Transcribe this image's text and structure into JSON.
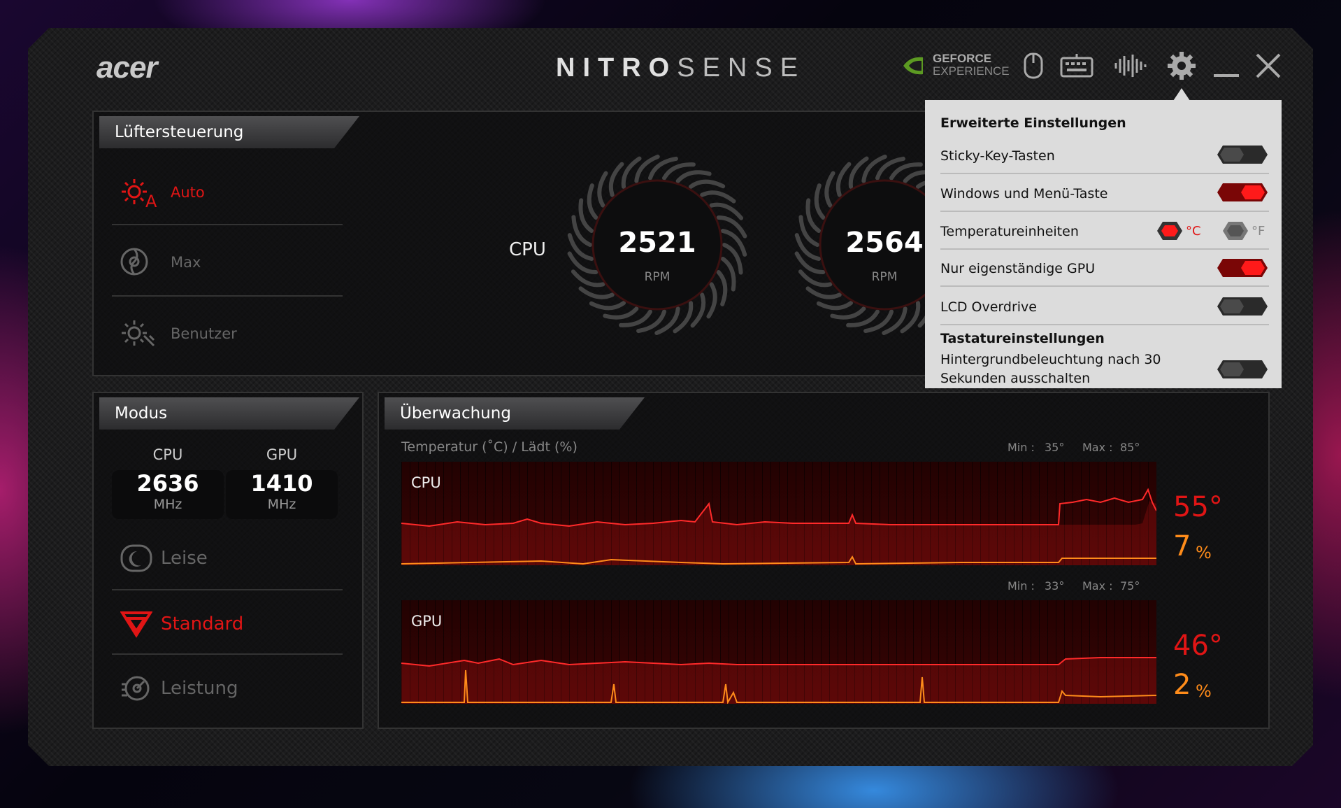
{
  "app": {
    "brand": "acer",
    "title_bold": "NITRO",
    "title_light": "SENSE"
  },
  "toolbar": {
    "geforce_line1": "GEFORCE",
    "geforce_line2": "EXPERIENCE"
  },
  "fan_control": {
    "tab": "Lüftersteuerung",
    "options": [
      {
        "label": "Auto",
        "active": true
      },
      {
        "label": "Max",
        "active": false
      },
      {
        "label": "Benutzer",
        "active": false
      }
    ],
    "cpu_label": "CPU",
    "cpu_rpm": "2521",
    "gpu_rpm": "2564",
    "unit": "RPM"
  },
  "mode": {
    "tab": "Modus",
    "cpu_label": "CPU",
    "gpu_label": "GPU",
    "cpu_freq": "2636",
    "gpu_freq": "1410",
    "freq_unit": "MHz",
    "options": [
      {
        "label": "Leise",
        "active": false
      },
      {
        "label": "Standard",
        "active": true
      },
      {
        "label": "Leistung",
        "active": false
      }
    ]
  },
  "monitoring": {
    "tab": "Überwachung",
    "subtitle": "Temperatur (˚C) / Lädt (%)",
    "min_label": "Min :",
    "max_label": "Max :",
    "cpu": {
      "label": "CPU",
      "min": "35°",
      "max": "85°",
      "temp": "55°",
      "load": "7",
      "load_unit": "%"
    },
    "gpu": {
      "label": "GPU",
      "min": "33°",
      "max": "75°",
      "temp": "46°",
      "load": "2",
      "load_unit": "%"
    }
  },
  "settings_popup": {
    "heading": "Erweiterte Einstellungen",
    "rows": [
      {
        "label": "Sticky-Key-Tasten",
        "on": false
      },
      {
        "label": "Windows und Menü-Taste",
        "on": true
      },
      {
        "label": "Temperatureinheiten",
        "type": "units"
      },
      {
        "label": "Nur eigenständige GPU",
        "on": true
      },
      {
        "label": "LCD Overdrive",
        "on": false
      }
    ],
    "units": {
      "celsius": "°C",
      "fahrenheit": "°F",
      "selected": "celsius"
    },
    "keyboard_heading": "Tastatureinstellungen",
    "keyboard_line1": "Hintergrundbeleuchtung nach 30",
    "keyboard_line2": "Sekunden ausschalten",
    "keyboard_on": false
  },
  "colors": {
    "accent": "#e01515",
    "load": "#ff8c1a",
    "inactive": "#777777"
  }
}
